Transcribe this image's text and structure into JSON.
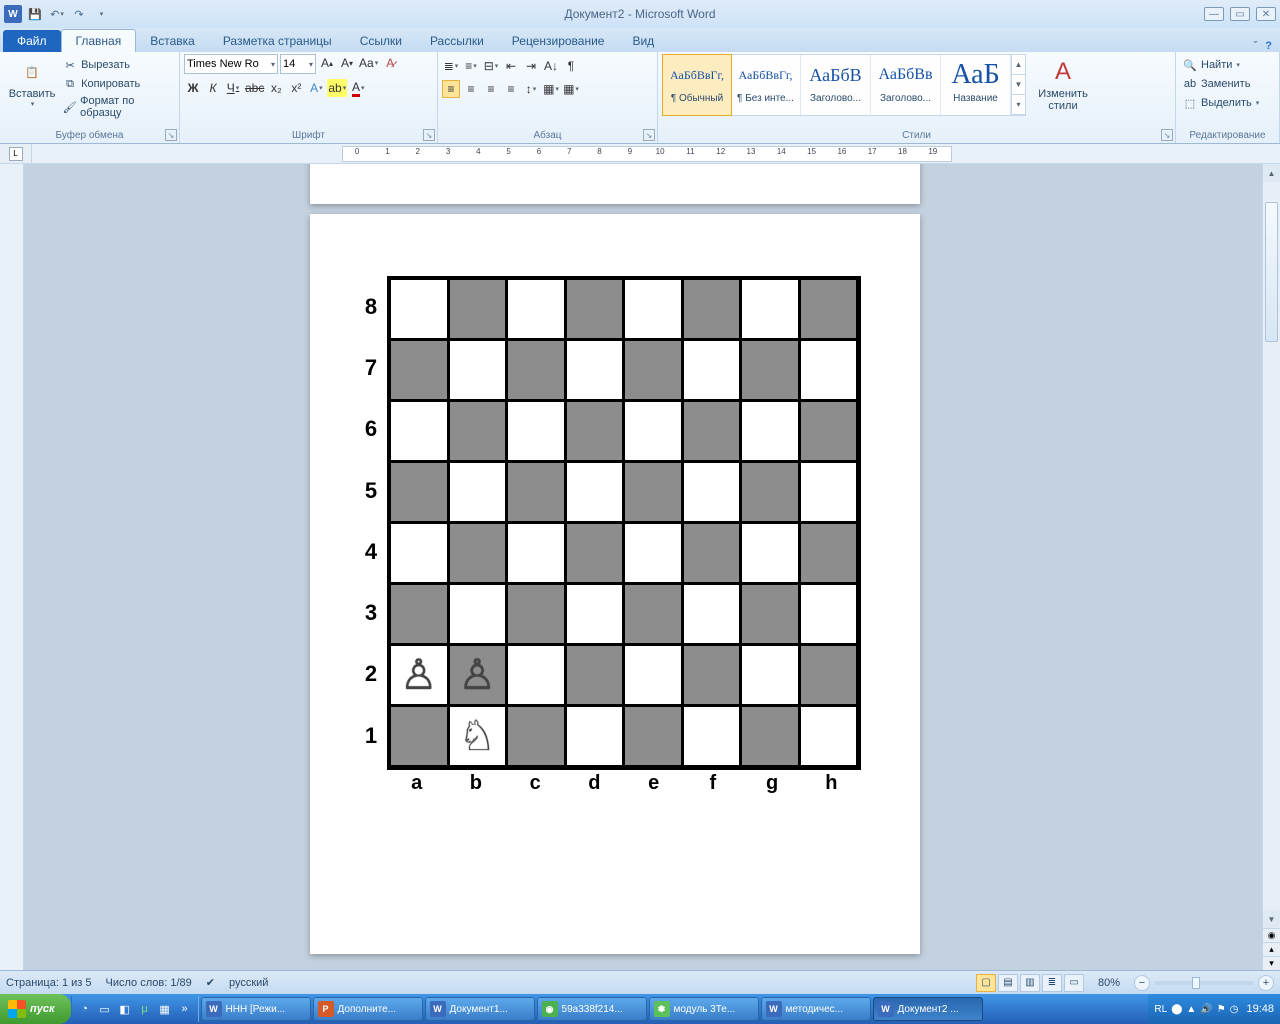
{
  "titlebar": {
    "title": "Документ2 - Microsoft Word"
  },
  "tabs": {
    "file": "Файл",
    "items": [
      "Главная",
      "Вставка",
      "Разметка страницы",
      "Ссылки",
      "Рассылки",
      "Рецензирование",
      "Вид"
    ],
    "active_index": 0
  },
  "ribbon": {
    "clipboard": {
      "title": "Буфер обмена",
      "paste": "Вставить",
      "cut": "Вырезать",
      "copy": "Копировать",
      "format_painter": "Формат по образцу"
    },
    "font": {
      "title": "Шрифт",
      "name": "Times New Ro",
      "size": "14"
    },
    "paragraph": {
      "title": "Абзац"
    },
    "styles": {
      "title": "Стили",
      "items": [
        {
          "preview": "АаБбВвГг,",
          "label": "¶ Обычный"
        },
        {
          "preview": "АаБбВвГг,",
          "label": "¶ Без инте..."
        },
        {
          "preview": "АаБбВ",
          "label": "Заголово..."
        },
        {
          "preview": "АаБбВв",
          "label": "Заголово..."
        },
        {
          "preview": "АаБ",
          "label": "Название"
        }
      ],
      "change": "Изменить стили"
    },
    "editing": {
      "title": "Редактирование",
      "find": "Найти",
      "replace": "Заменить",
      "select": "Выделить"
    }
  },
  "statusbar": {
    "page": "Страница: 1 из 5",
    "words": "Число слов: 1/89",
    "lang": "русский",
    "zoom": "80%"
  },
  "taskbar": {
    "start": "пуск",
    "tasks": [
      {
        "icon": "W",
        "label": "ННН [Режи...",
        "color": "#3a6bbd"
      },
      {
        "icon": "P",
        "label": "Дополните...",
        "color": "#d45a2a"
      },
      {
        "icon": "W",
        "label": "Документ1...",
        "color": "#3a6bbd"
      },
      {
        "icon": "◉",
        "label": "59a338f214...",
        "color": "#4caf50"
      },
      {
        "icon": "❃",
        "label": "модуль 3Те...",
        "color": "#5cc05c"
      },
      {
        "icon": "W",
        "label": "методичес...",
        "color": "#3a6bbd"
      },
      {
        "icon": "W",
        "label": "Документ2 ...",
        "color": "#3a6bbd",
        "active": true
      }
    ],
    "lang": "RL",
    "time": "19:48"
  },
  "chess": {
    "ranks": [
      "8",
      "7",
      "6",
      "5",
      "4",
      "3",
      "2",
      "1"
    ],
    "files": [
      "a",
      "b",
      "c",
      "d",
      "e",
      "f",
      "g",
      "h"
    ],
    "pieces": {
      "a2": "♙",
      "b2": "♙",
      "b1": "♘"
    }
  }
}
